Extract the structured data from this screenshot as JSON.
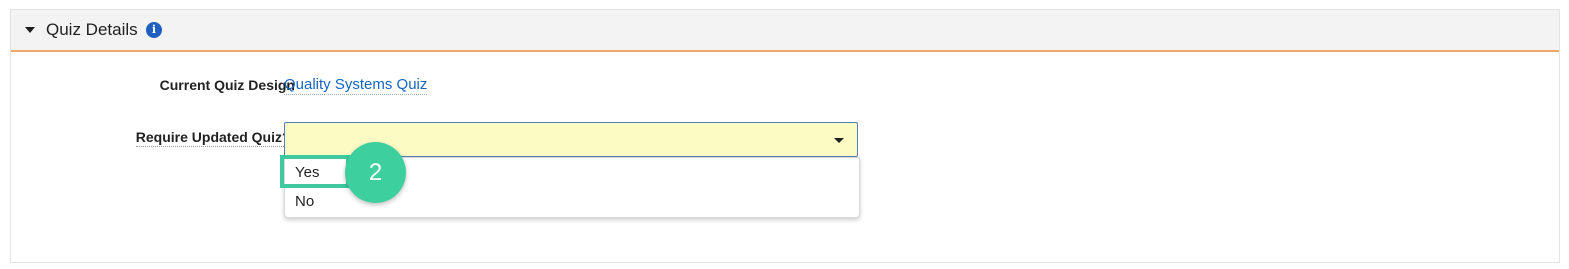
{
  "section": {
    "title": "Quiz Details",
    "info_icon": "i"
  },
  "fields": {
    "current_quiz_design": {
      "label": "Current Quiz Design",
      "value": "Quality Systems Quiz"
    },
    "require_updated_quiz": {
      "label": "Require Updated Quiz?*",
      "selected_value": "",
      "options": [
        "Yes",
        "No"
      ]
    }
  },
  "annotation": {
    "step_number": "2"
  },
  "colors": {
    "header_accent": "#f0a868",
    "select_background": "#fdfbc4",
    "link": "#1565c0",
    "callout": "#3ec99e"
  }
}
